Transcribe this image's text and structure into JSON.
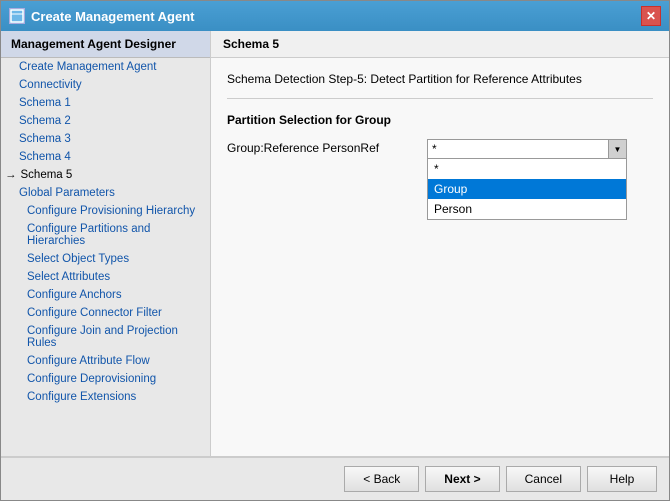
{
  "window": {
    "title": "Create Management Agent",
    "close_label": "✕",
    "icon_label": "M"
  },
  "sidebar": {
    "header": "Management Agent Designer",
    "items": [
      {
        "id": "create",
        "label": "Create Management Agent",
        "indent": 1,
        "active": false
      },
      {
        "id": "connectivity",
        "label": "Connectivity",
        "indent": 1,
        "active": false
      },
      {
        "id": "schema1",
        "label": "Schema 1",
        "indent": 1,
        "active": false
      },
      {
        "id": "schema2",
        "label": "Schema 2",
        "indent": 1,
        "active": false
      },
      {
        "id": "schema3",
        "label": "Schema 3",
        "indent": 1,
        "active": false
      },
      {
        "id": "schema4",
        "label": "Schema 4",
        "indent": 1,
        "active": false
      },
      {
        "id": "schema5",
        "label": "Schema 5",
        "indent": 1,
        "active": true
      },
      {
        "id": "global",
        "label": "Global Parameters",
        "indent": 1,
        "active": false
      },
      {
        "id": "prov-hierarchy",
        "label": "Configure Provisioning Hierarchy",
        "indent": 2,
        "active": false
      },
      {
        "id": "partitions",
        "label": "Configure Partitions and Hierarchies",
        "indent": 2,
        "active": false
      },
      {
        "id": "object-types",
        "label": "Select Object Types",
        "indent": 2,
        "active": false
      },
      {
        "id": "attributes",
        "label": "Select Attributes",
        "indent": 2,
        "active": false
      },
      {
        "id": "anchors",
        "label": "Configure Anchors",
        "indent": 2,
        "active": false
      },
      {
        "id": "connector-filter",
        "label": "Configure Connector Filter",
        "indent": 2,
        "active": false
      },
      {
        "id": "join-projection",
        "label": "Configure Join and Projection Rules",
        "indent": 2,
        "active": false
      },
      {
        "id": "attribute-flow",
        "label": "Configure Attribute Flow",
        "indent": 2,
        "active": false
      },
      {
        "id": "deprovisioning",
        "label": "Configure Deprovisioning",
        "indent": 2,
        "active": false
      },
      {
        "id": "extensions",
        "label": "Configure Extensions",
        "indent": 2,
        "active": false
      }
    ]
  },
  "main": {
    "header": "Schema 5",
    "step_title": "Schema Detection Step-5: Detect Partition for Reference Attributes",
    "partition_label": "Partition Selection for Group",
    "field_label": "Group:Reference PersonRef",
    "dropdown_value": "*",
    "dropdown_options": [
      {
        "label": "*",
        "value": "*"
      },
      {
        "label": "Group",
        "value": "Group"
      },
      {
        "label": "Person",
        "value": "Person"
      }
    ],
    "dropdown_highlighted": "Group"
  },
  "footer": {
    "back_label": "< Back",
    "next_label": "Next >",
    "cancel_label": "Cancel",
    "help_label": "Help"
  }
}
